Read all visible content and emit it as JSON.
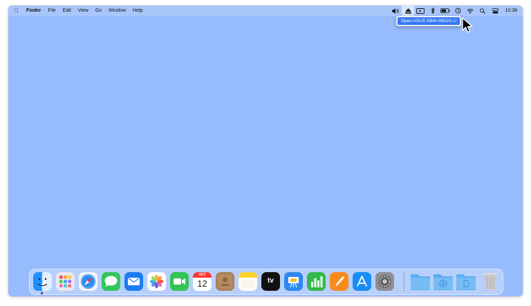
{
  "menubar": {
    "app_name": "Finder",
    "menus": [
      "File",
      "Edit",
      "View",
      "Go",
      "Window",
      "Help"
    ],
    "clock": "10:38"
  },
  "dropdown": {
    "item_label": "Open ASUS SBW-06D2X-U"
  },
  "dock": {
    "apps": [
      {
        "name": "Finder",
        "icon": "finder-icon",
        "running": true
      },
      {
        "name": "Launchpad",
        "icon": "launchpad-icon"
      },
      {
        "name": "Safari",
        "icon": "safari-icon"
      },
      {
        "name": "Messages",
        "icon": "messages-icon"
      },
      {
        "name": "Mail",
        "icon": "mail-icon"
      },
      {
        "name": "Photos",
        "icon": "photos-icon"
      },
      {
        "name": "FaceTime",
        "icon": "facetime-icon"
      },
      {
        "name": "Calendar",
        "icon": "calendar-icon"
      },
      {
        "name": "Contacts",
        "icon": "contacts-icon"
      },
      {
        "name": "Notes",
        "icon": "notes-icon"
      },
      {
        "name": "TV",
        "icon": "appletv-icon"
      },
      {
        "name": "Keynote",
        "icon": "keynote-icon"
      },
      {
        "name": "Numbers",
        "icon": "numbers-icon"
      },
      {
        "name": "Pages",
        "icon": "pages-icon"
      },
      {
        "name": "App Store",
        "icon": "appstore-icon"
      },
      {
        "name": "System Preferences",
        "icon": "settings-icon"
      }
    ],
    "calendar_month": "OCT",
    "calendar_day": "12",
    "tv_label": "tv"
  },
  "colors": {
    "desktop": "#97bcfd",
    "menu_highlight": "#3478f6"
  }
}
